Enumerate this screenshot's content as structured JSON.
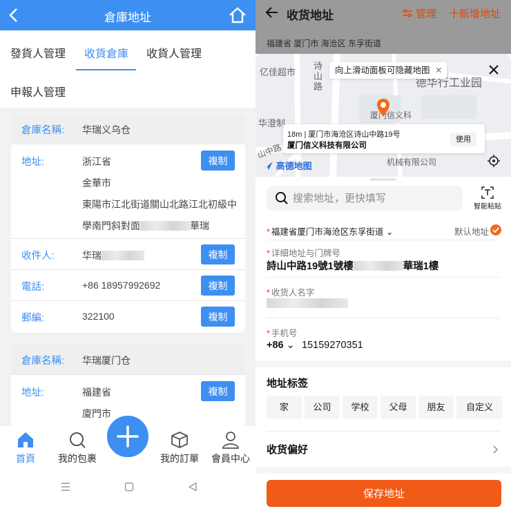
{
  "left": {
    "header": {
      "title": "倉庫地址"
    },
    "tabs": [
      {
        "label": "發貨人管理",
        "active": false
      },
      {
        "label": "收貨倉庫",
        "active": true
      },
      {
        "label": "收貨人管理",
        "active": false
      },
      {
        "label": "申報人管理",
        "active": false
      }
    ],
    "copy_label": "複制",
    "warehouses": [
      {
        "name_label": "倉庫名稱:",
        "name": "华瑞义乌仓",
        "address_label": "地址:",
        "address_lines": [
          "浙江省",
          "金華市",
          "東陽市江北街道關山北路江北初級中",
          "學南門斜對面"
        ],
        "address_tail": "華瑞",
        "recipient_label": "收件人:",
        "recipient": "华瑞",
        "phone_label": "電話:",
        "phone": "+86 18957992692",
        "zip_label": "郵編:",
        "zip": "322100"
      },
      {
        "name_label": "倉庫名稱:",
        "name": "华瑞厦门仓",
        "address_label": "地址:",
        "address_lines": [
          "福建省",
          "廈門市"
        ]
      }
    ],
    "bottom_nav": [
      {
        "label": "首頁",
        "icon": "home-icon",
        "active": true
      },
      {
        "label": "我的包裹",
        "icon": "search-icon",
        "active": false
      },
      {
        "label": "我的訂單",
        "icon": "box-icon",
        "active": false
      },
      {
        "label": "會員中心",
        "icon": "user-icon",
        "active": false
      }
    ],
    "accent": "#3d8ff2"
  },
  "right": {
    "header": {
      "title": "收货地址",
      "manage": "管理",
      "add": "十新增地址",
      "region": "福建省 厦门市 海沧区 东孚街道"
    },
    "map": {
      "tip": "向上滑动面板可隐藏地图",
      "labels": [
        "亿佳超市",
        "诗山路",
        "德华行工业园",
        "厦门信义科",
        "华澄制",
        "山中路",
        "机械有限公司"
      ],
      "card_line1": "18m | 厦门市海沧区诗山中路19号",
      "card_line2": "厦门信义科技有限公司",
      "use": "使用",
      "logo": "高德地图"
    },
    "search": {
      "placeholder": "搜索地址，更快填写"
    },
    "smart_paste": "智能粘贴",
    "region_field": "福建省厦门市海沧区东孚街道",
    "default_label": "默认地址",
    "detail_label": "详细地址与门牌号",
    "detail_value_prefix": "詩山中路19號1號樓",
    "detail_value_suffix": "華瑞1樓",
    "name_label": "收货人名字",
    "phone_label": "手机号",
    "phone_code": "+86",
    "phone": "15159270351",
    "tags_title": "地址标签",
    "tags": [
      "家",
      "公司",
      "学校",
      "父母",
      "朋友",
      "自定义"
    ],
    "pref": "收货偏好",
    "save": "保存地址",
    "accent": "#f25a17"
  }
}
